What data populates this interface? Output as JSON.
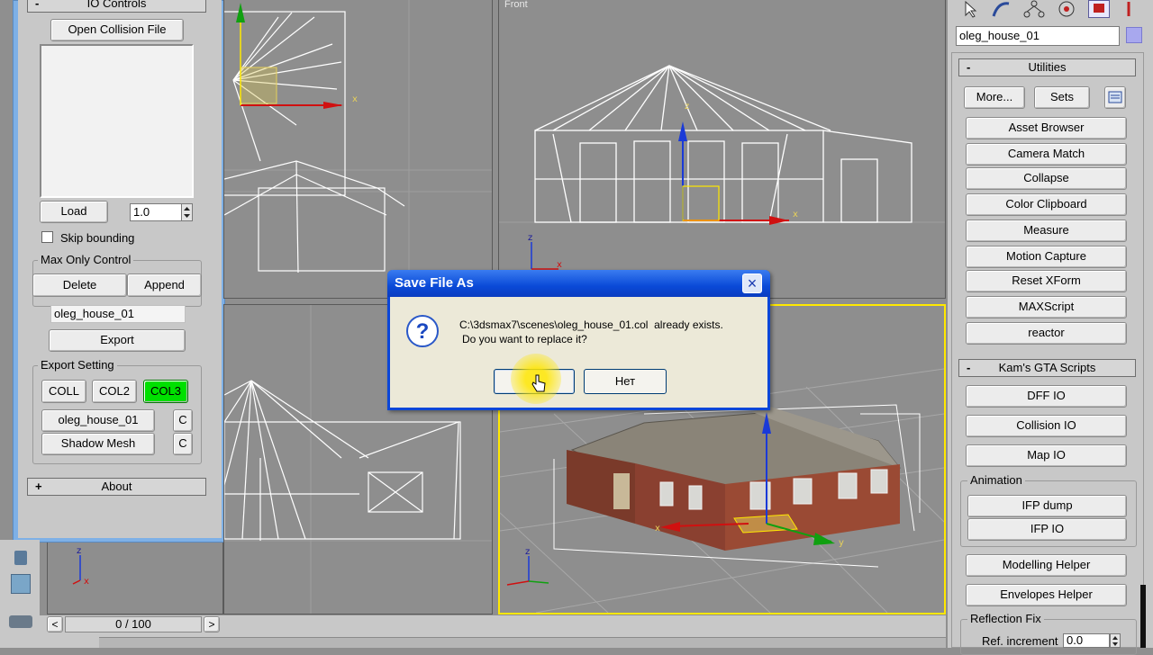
{
  "left_panel": {
    "rollout_title": "IO Controls",
    "open_collision_file": "Open Collision File",
    "load_button": "Load",
    "version_value": "1.0",
    "skip_bounding_label": "Skip bounding",
    "max_only_group": "Max Only Control",
    "delete_button": "Delete",
    "append_button": "Append",
    "object_name": "oleg_house_01",
    "export_button": "Export",
    "export_setting_group": "Export Setting",
    "format_buttons": [
      "COLL",
      "COL2",
      "COL3"
    ],
    "active_format": "COL3",
    "mesh_name_button": "oleg_house_01",
    "mesh_c_button": "C",
    "shadow_mesh_button": "Shadow Mesh",
    "shadow_c_button": "C",
    "about_rollout": "About",
    "about_sign": "+",
    "collapse_sign": "-"
  },
  "viewports": {
    "front_label": "Front",
    "axis_x": "x",
    "axis_y": "y",
    "axis_z": "z"
  },
  "timeline": {
    "frame_counter": "0 / 100",
    "prev_arrow": "<",
    "next_arrow": ">"
  },
  "dialog": {
    "title": "Save File As",
    "message_line1": "C:\\3dsmax7\\scenes\\oleg_house_01.col  already exists.",
    "message_line2": "Do you want to replace it?",
    "no_button": "Нет",
    "close_icon": "×"
  },
  "right_panel": {
    "object_name": "oleg_house_01",
    "utilities_title": "Utilities",
    "more_button": "More...",
    "sets_button": "Sets",
    "utilities": [
      "Asset Browser",
      "Camera Match",
      "Collapse",
      "Color Clipboard",
      "Measure",
      "Motion Capture",
      "Reset XForm",
      "MAXScript",
      "reactor"
    ],
    "gta_title": "Kam's GTA Scripts",
    "gta_buttons": [
      "DFF IO",
      "Collision IO",
      "Map IO"
    ],
    "animation_group": "Animation",
    "animation_buttons": [
      "IFP dump",
      "IFP IO"
    ],
    "helper_buttons": [
      "Modelling Helper",
      "Envelopes Helper"
    ],
    "reflection_group": "Reflection Fix",
    "ref_increment_label": "Ref. increment",
    "ref_increment_value": "0.0",
    "collapse_sign": "-"
  },
  "colors": {
    "active_format": "#00e000",
    "viewport_bg": "#8e8e8e",
    "active_viewport_border": "#ffe800",
    "dialog_title_bar": "#2a5fd8",
    "panel_bg": "#c8c8c8"
  }
}
